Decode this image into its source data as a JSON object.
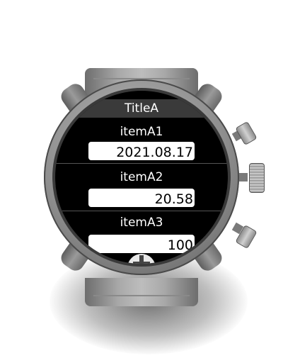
{
  "screen": {
    "title": "TitleA",
    "items": [
      {
        "label": "itemA1",
        "value": "2021.08.17"
      },
      {
        "label": "itemA2",
        "value": "20.58"
      },
      {
        "label": "itemA3",
        "value": "100"
      }
    ]
  },
  "icons": {
    "add_button": "plus-icon"
  },
  "colors": {
    "screen_background": "#000000",
    "title_bar": "#3a3a3a",
    "field_background": "#ffffff",
    "text_on_screen": "#ffffff"
  }
}
